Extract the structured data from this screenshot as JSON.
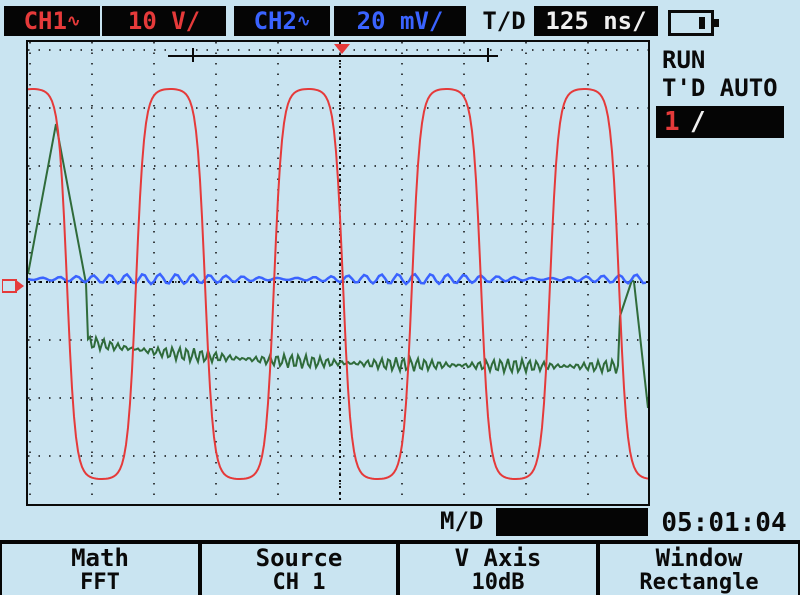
{
  "top_bar": {
    "ch1_tag": "CH1",
    "ch1_scale": "10 V/",
    "ch2_tag": "CH2",
    "ch2_scale": "20 mV/",
    "timebase_label": "T/D",
    "timebase_value": "125 ns/"
  },
  "status": {
    "run_state": "RUN",
    "trigger_mode": "T'D AUTO",
    "trigger_source": "1",
    "trigger_edge_icon": "rising-edge-icon",
    "battery_icon": "battery-icon"
  },
  "bottom": {
    "md_label": "M/D",
    "md_value": "",
    "clock": "05:01:04"
  },
  "softkeys": [
    {
      "title": "Math",
      "value": "FFT"
    },
    {
      "title": "Source",
      "value": "CH 1"
    },
    {
      "title": "V Axis",
      "value": "10dB"
    },
    {
      "title": "Window",
      "value": "Rectangle"
    }
  ],
  "colors": {
    "background": "#c9e4f1",
    "ch1": "#e53a3a",
    "ch2": "#3a63ff",
    "math": "#2f6b3a",
    "panel": "#050505"
  },
  "traces": {
    "ch1_color": "#e53a3a",
    "ch2_color": "#3a63ff",
    "math_color": "#2f6b3a"
  }
}
